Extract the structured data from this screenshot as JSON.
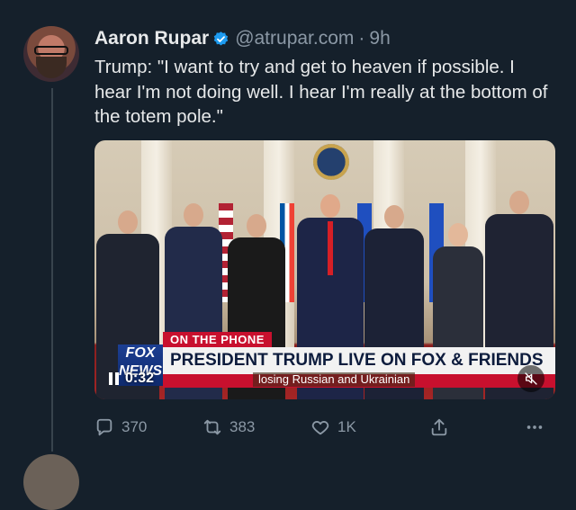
{
  "author": {
    "name": "Aaron Rupar",
    "handle": "@atrupar.com",
    "separator": "·",
    "time": "9h"
  },
  "tweet": {
    "text": "Trump: \"I want to try and get to heaven if possible. I hear I'm not doing well. I hear I'm really at the bottom of the totem pole.\""
  },
  "media": {
    "tag": "ON THE PHONE",
    "logo_line1": "FOX",
    "logo_line2": "NEWS",
    "headline": "PRESIDENT TRUMP LIVE ON FOX & FRIENDS",
    "ticker": "losing Russian and Ukrainian",
    "time": "0:32",
    "icons": {
      "pause": "pause-icon",
      "mute": "mute-icon"
    }
  },
  "actions": {
    "replies": "370",
    "reposts": "383",
    "likes": "1K"
  },
  "colors": {
    "background": "#15202b",
    "text": "#e7e9ea",
    "muted": "#8b98a5",
    "verified": "#1d9bf0",
    "fox_red": "#c8102e"
  }
}
